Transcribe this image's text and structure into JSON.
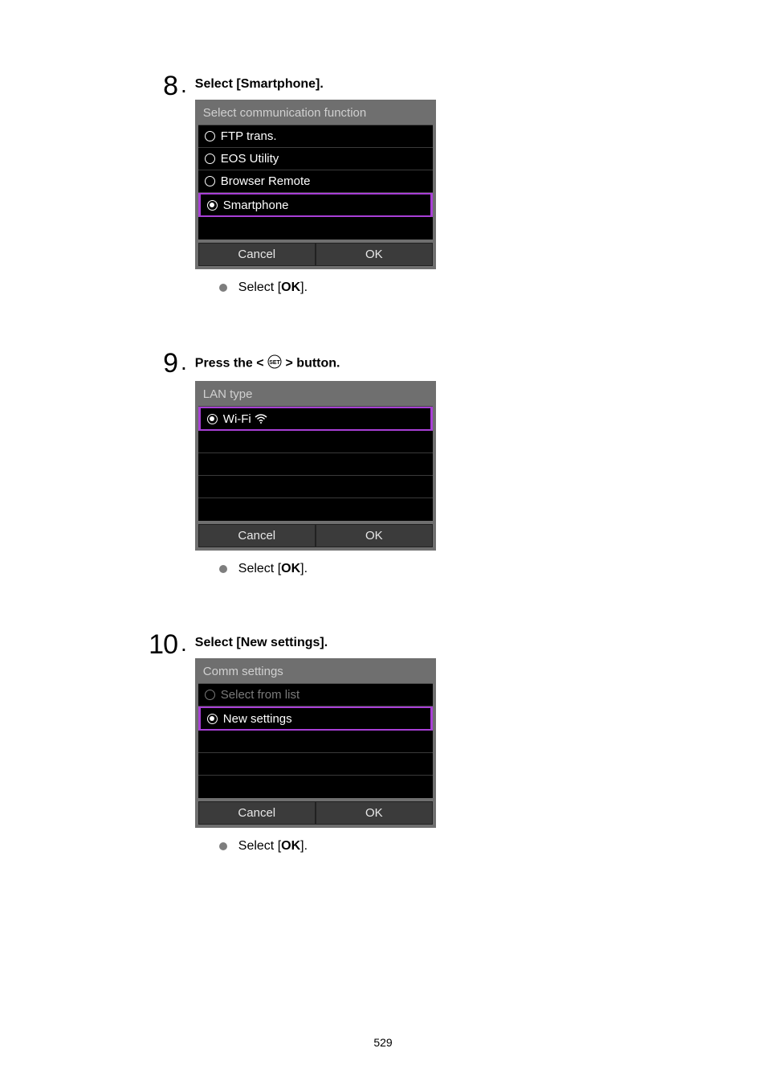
{
  "page_number": "529",
  "steps": [
    {
      "number": "8",
      "title_parts": {
        "pre": "Select [",
        "bold": "Smartphone",
        "post": "]."
      },
      "screenshot": {
        "title": "Select communication function",
        "rows": [
          {
            "label": "FTP trans.",
            "kind": "radio",
            "selected": false
          },
          {
            "label": "EOS Utility",
            "kind": "radio",
            "selected": false
          },
          {
            "label": "Browser Remote",
            "kind": "radio",
            "selected": false
          },
          {
            "label": "Smartphone",
            "kind": "radio",
            "selected": true
          }
        ],
        "empty_rows": 1,
        "footer": {
          "left": "Cancel",
          "right": "OK"
        }
      },
      "sub": {
        "pre": "Select [",
        "bold": "OK",
        "post": "]."
      }
    },
    {
      "number": "9",
      "title_set": {
        "pre": "Press the < ",
        "post": " > button."
      },
      "screenshot": {
        "title": "LAN type",
        "rows": [
          {
            "label": "Wi-Fi",
            "kind": "wifi",
            "selected": true
          }
        ],
        "empty_rows": 4,
        "footer": {
          "left": "Cancel",
          "right": "OK"
        }
      },
      "sub": {
        "pre": "Select [",
        "bold": "OK",
        "post": "]."
      }
    },
    {
      "number": "10",
      "title_parts": {
        "pre": "Select [",
        "bold": "New settings",
        "post": "]."
      },
      "screenshot": {
        "title": "Comm settings",
        "rows": [
          {
            "label": "Select from list",
            "kind": "radio",
            "selected": false,
            "dim": true
          },
          {
            "label": "New settings",
            "kind": "radio",
            "selected": true
          }
        ],
        "empty_rows": 3,
        "footer": {
          "left": "Cancel",
          "right": "OK"
        }
      },
      "sub": {
        "pre": "Select [",
        "bold": "OK",
        "post": "]."
      }
    }
  ]
}
